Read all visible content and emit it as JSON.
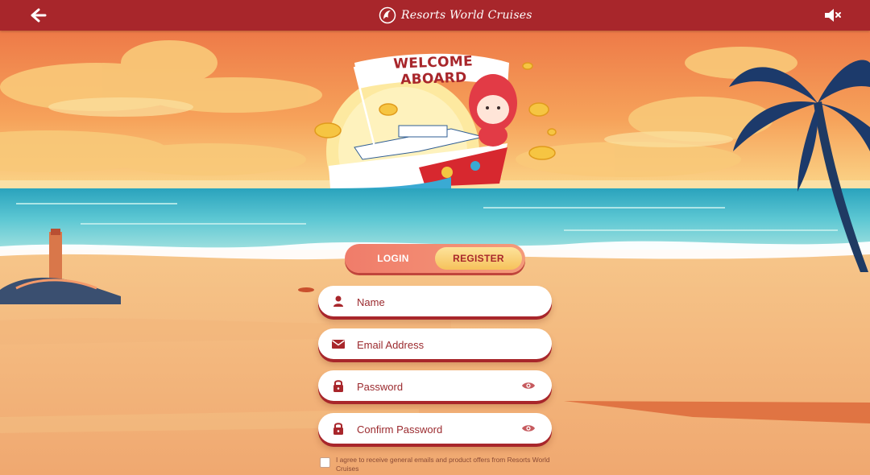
{
  "header": {
    "back_icon": "arrow-left-icon",
    "logo_text": "Resorts World Cruises",
    "mute_icon": "speaker-muted-icon",
    "bar_color": "#a8262b"
  },
  "banner": {
    "title": "WELCOME ABOARD"
  },
  "tabs": [
    {
      "label": "LOGIN",
      "active": false
    },
    {
      "label": "REGISTER",
      "active": true
    }
  ],
  "form": {
    "name": {
      "placeholder": "Name",
      "value": "",
      "icon": "user-icon"
    },
    "email": {
      "placeholder": "Email Address",
      "value": "",
      "icon": "envelope-icon"
    },
    "password": {
      "placeholder": "Password",
      "value": "",
      "icon": "lock-icon"
    },
    "confirm_password": {
      "placeholder": "Confirm Password",
      "value": "",
      "icon": "lock-icon"
    }
  },
  "consent": {
    "checked": false,
    "text": "I agree to receive general emails and product offers from Resorts World Cruises"
  },
  "colors": {
    "accent": "#a8262b",
    "tab_active": "#f6c25b",
    "sand": "#f3b67a",
    "sea": "#39b6c9"
  }
}
